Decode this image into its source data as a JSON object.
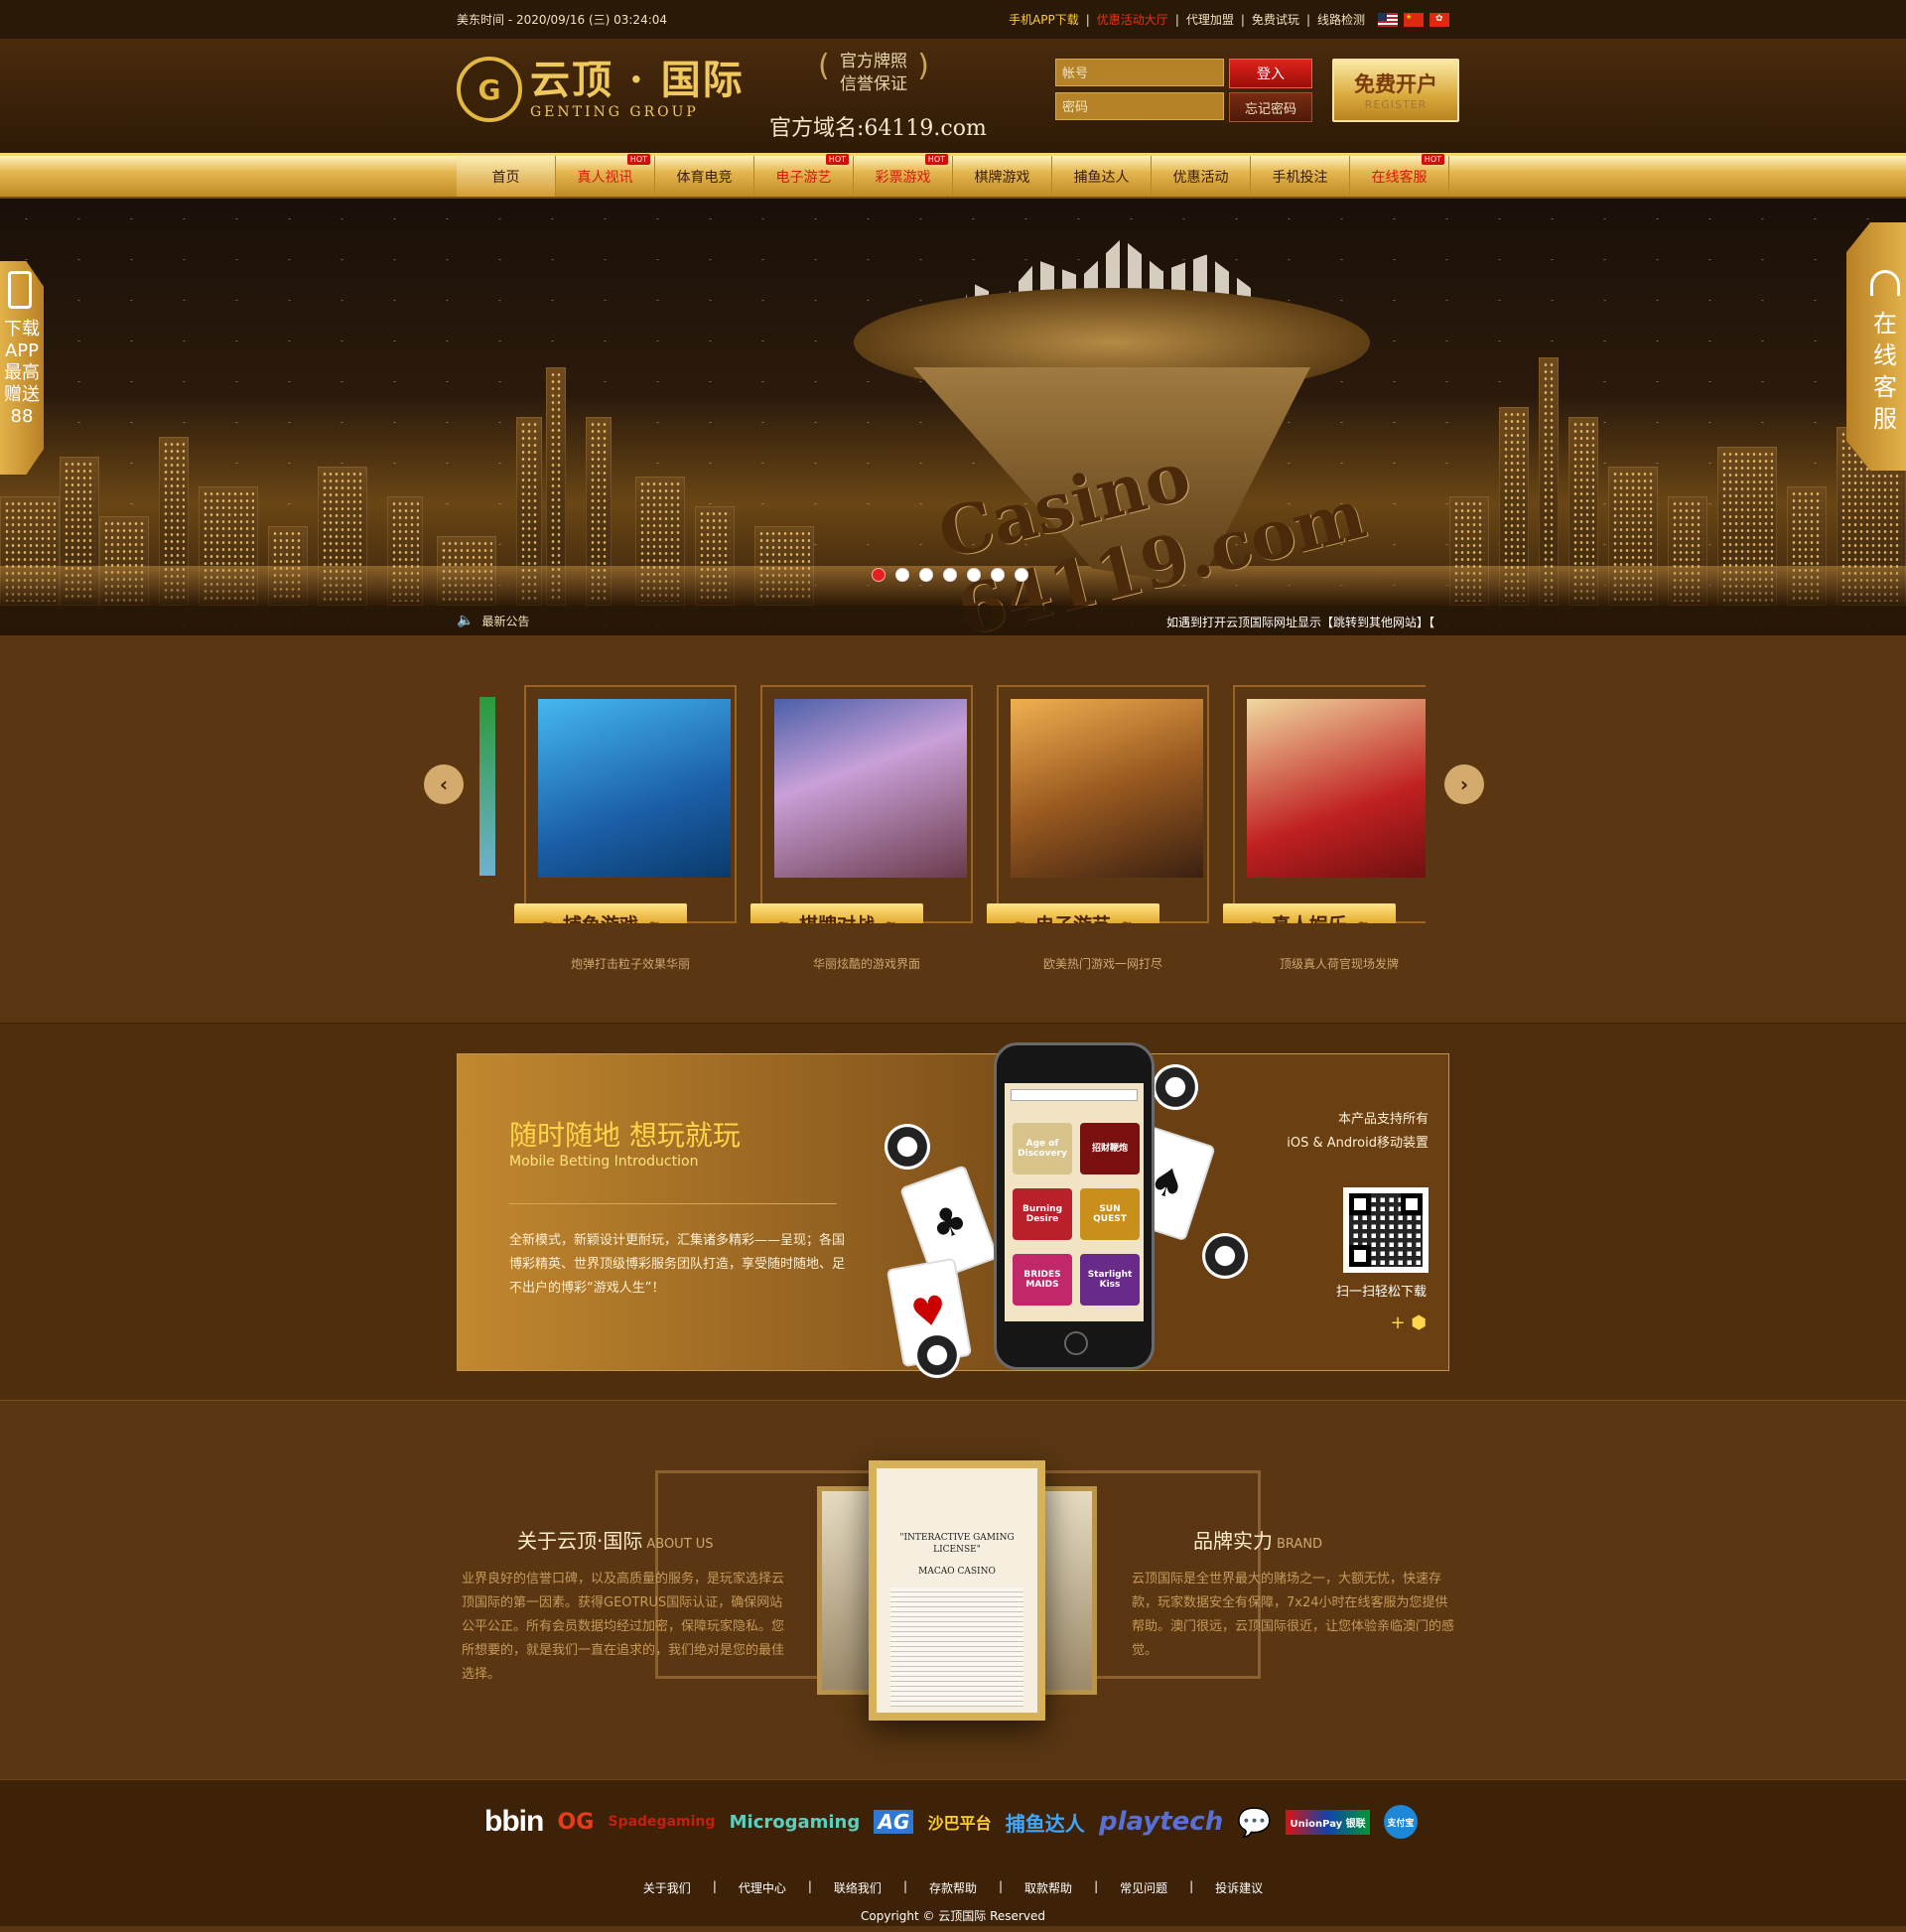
{
  "topbar": {
    "time_label": "美东时间 - 2020/09/16 (三) 03:24:04",
    "links": [
      {
        "label": "手机APP下载",
        "style": "gold"
      },
      {
        "label": "优惠活动大厅",
        "style": "red"
      },
      {
        "label": "代理加盟",
        "style": ""
      },
      {
        "label": "免费试玩",
        "style": ""
      },
      {
        "label": "线路检测",
        "style": ""
      }
    ],
    "flags": [
      "us-flag-icon",
      "cn-flag-icon",
      "hk-flag-icon"
    ]
  },
  "header": {
    "logo_cn": "云顶 · 国际",
    "logo_en": "GENTING GROUP",
    "badge_line1": "官方牌照",
    "badge_line2": "信誉保证",
    "domain": "官方域名:64119.com",
    "login": {
      "username_placeholder": "帐号",
      "password_placeholder": "密码",
      "login_label": "登入",
      "forgot_label": "忘记密码"
    },
    "register": {
      "label": "免费开户",
      "sub": "REGISTER"
    }
  },
  "nav": {
    "items": [
      {
        "label": "首页",
        "active": true,
        "hot": false,
        "red": false
      },
      {
        "label": "真人视讯",
        "active": false,
        "hot": true,
        "red": true
      },
      {
        "label": "体育电竞",
        "active": false,
        "hot": false,
        "red": false
      },
      {
        "label": "电子游艺",
        "active": false,
        "hot": true,
        "red": true
      },
      {
        "label": "彩票游戏",
        "active": false,
        "hot": true,
        "red": true
      },
      {
        "label": "棋牌游戏",
        "active": false,
        "hot": false,
        "red": false
      },
      {
        "label": "捕鱼达人",
        "active": false,
        "hot": false,
        "red": false
      },
      {
        "label": "优惠活动",
        "active": false,
        "hot": false,
        "red": false
      },
      {
        "label": "手机投注",
        "active": false,
        "hot": false,
        "red": false
      },
      {
        "label": "在线客服",
        "active": false,
        "hot": true,
        "red": true
      }
    ],
    "hot_label": "HOT"
  },
  "banner": {
    "casino_text": "Casino 64119.com",
    "dots": 7,
    "active_dot": 0,
    "notice_label": "最新公告",
    "notice_text": "如遇到打开云顶国际网址显示【跳转到其他网站】【"
  },
  "side": {
    "left_lines": [
      "下载",
      "APP",
      "最高",
      "赠送",
      "88"
    ],
    "right_lines": [
      "在",
      "线",
      "客",
      "服"
    ],
    "left2_lines": [
      "最高",
      "赠送",
      "88"
    ],
    "right2_lines": [
      "客",
      "服"
    ]
  },
  "games": {
    "cards": [
      {
        "title": "捕鱼游戏",
        "desc": "炮弹打击粒子效果华丽"
      },
      {
        "title": "棋牌对战",
        "desc": "华丽炫酷的游戏界面"
      },
      {
        "title": "电子游艺",
        "desc": "欧美热门游戏一网打尽"
      },
      {
        "title": "真人娱乐",
        "desc": "顶级真人荷官现场发牌"
      }
    ]
  },
  "mobile": {
    "title": "随时随地 想玩就玩",
    "subtitle": "Mobile Betting Introduction",
    "desc": "全新模式，新颖设计更耐玩，汇集诸多精彩——呈现；各国博彩精英、世界顶级博彩服务团队打造，享受随时随地、足不出户的博彩“游戏人生”！",
    "support_line1": "本产品支持所有",
    "support_line2": "iOS & Android移动装置",
    "qr_label": "扫一扫轻松下载",
    "os_label": "+",
    "screen_tiles": [
      "Age of Discovery",
      "招财鞭炮",
      "Burning Desire",
      "SUN QUEST",
      "BRIDES MAIDS",
      "Starlight Kiss"
    ]
  },
  "about": {
    "left_title": "关于云顶·国际",
    "left_title_en": "ABOUT US",
    "left_text": "业界良好的信誉口碑，以及高质量的服务，是玩家选择云顶国际的第一因素。获得GEOTRUS国际认证，确保网站公平公正。所有会员数据均经过加密，保障玩家隐私。您所想要的，就是我们一直在追求的，我们绝对是您的最佳选择。",
    "right_title": "品牌实力",
    "right_title_en": "BRAND",
    "right_text": "云顶国际是全世界最大的赌场之一，大额无忧，快速存款，玩家数据安全有保障，7x24小时在线客服为您提供帮助。澳门很远，云顶国际很近，让您体验亲临澳门的感觉。",
    "cert_title": "\"INTERACTIVE GAMING LICENSE\"",
    "cert_name": "MACAO CASINO"
  },
  "footer": {
    "partners": [
      "bbin",
      "OG",
      "Spadegaming",
      "Microgaming",
      "AG",
      "沙巴平台",
      "捕鱼达人",
      "playtech",
      "WeChat",
      "UnionPay 银联",
      "支付宝"
    ],
    "links": [
      "关于我们",
      "代理中心",
      "联络我们",
      "存款帮助",
      "取款帮助",
      "常见问题",
      "投诉建议"
    ],
    "copyright": "Copyright © 云顶国际 Reserved"
  }
}
